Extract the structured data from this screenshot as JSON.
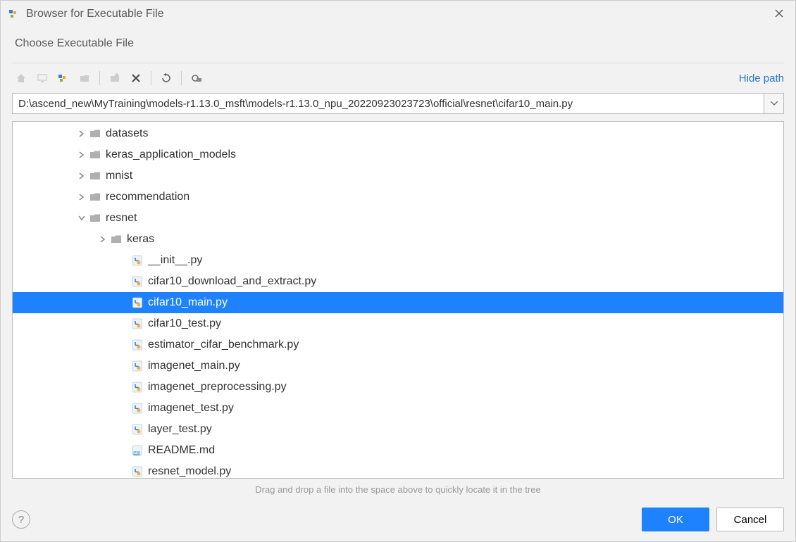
{
  "title": "Browser for Executable File",
  "subtitle": "Choose Executable File",
  "hide_path_label": "Hide path",
  "path": "D:\\ascend_new\\MyTraining\\models-r1.13.0_msft\\models-r1.13.0_npu_20220923023723\\official\\resnet\\cifar10_main.py",
  "hint": "Drag and drop a file into the space above to quickly locate it in the tree",
  "ok_label": "OK",
  "cancel_label": "Cancel",
  "tree": [
    {
      "label": "datasets",
      "type": "folder",
      "indent": 3,
      "chev": "right"
    },
    {
      "label": "keras_application_models",
      "type": "folder",
      "indent": 3,
      "chev": "right"
    },
    {
      "label": "mnist",
      "type": "folder",
      "indent": 3,
      "chev": "right"
    },
    {
      "label": "recommendation",
      "type": "folder",
      "indent": 3,
      "chev": "right"
    },
    {
      "label": "resnet",
      "type": "folder",
      "indent": 3,
      "chev": "down"
    },
    {
      "label": "keras",
      "type": "folder",
      "indent": 4,
      "chev": "right"
    },
    {
      "label": "__init__.py",
      "type": "py",
      "indent": 5
    },
    {
      "label": "cifar10_download_and_extract.py",
      "type": "py",
      "indent": 5
    },
    {
      "label": "cifar10_main.py",
      "type": "py",
      "indent": 5,
      "selected": true
    },
    {
      "label": "cifar10_test.py",
      "type": "py",
      "indent": 5
    },
    {
      "label": "estimator_cifar_benchmark.py",
      "type": "py",
      "indent": 5
    },
    {
      "label": "imagenet_main.py",
      "type": "py",
      "indent": 5
    },
    {
      "label": "imagenet_preprocessing.py",
      "type": "py",
      "indent": 5
    },
    {
      "label": "imagenet_test.py",
      "type": "py",
      "indent": 5
    },
    {
      "label": "layer_test.py",
      "type": "py",
      "indent": 5
    },
    {
      "label": "README.md",
      "type": "md",
      "indent": 5
    },
    {
      "label": "resnet_model.py",
      "type": "py",
      "indent": 5
    }
  ]
}
